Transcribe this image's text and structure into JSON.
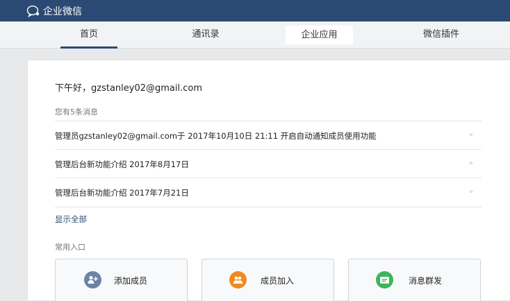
{
  "app": {
    "brand_name": "企业微信",
    "brand_icon": "chat-bubble-icon",
    "bar_color": "#2b4a73"
  },
  "nav": {
    "tabs": [
      {
        "label": "首页",
        "state": "active"
      },
      {
        "label": "通讯录",
        "state": "normal"
      },
      {
        "label": "企业应用",
        "state": "highlighted"
      },
      {
        "label": "微信插件",
        "state": "normal"
      }
    ]
  },
  "home": {
    "greeting": "下午好，gzstanley02@gmail.com",
    "message_count_text": "您有5条消息",
    "messages": [
      {
        "text": "管理员gzstanley02@gmail.com于 2017年10月10日 21:11 开启自动通知成员使用功能",
        "chevron": "»"
      },
      {
        "text": "管理后台新功能介绍 2017年8月17日",
        "chevron": "»"
      },
      {
        "text": "管理后台新功能介绍 2017年7月21日",
        "chevron": "»"
      }
    ],
    "show_all": "显示全部",
    "shortcuts_title": "常用入口",
    "shortcuts": [
      {
        "label": "添加成员",
        "icon": "add-person-icon",
        "color": "#6b84a6"
      },
      {
        "label": "成员加入",
        "icon": "two-people-icon",
        "color": "#ef8a1f"
      },
      {
        "label": "消息群发",
        "icon": "message-broadcast-icon",
        "color": "#3cb55c"
      }
    ]
  }
}
